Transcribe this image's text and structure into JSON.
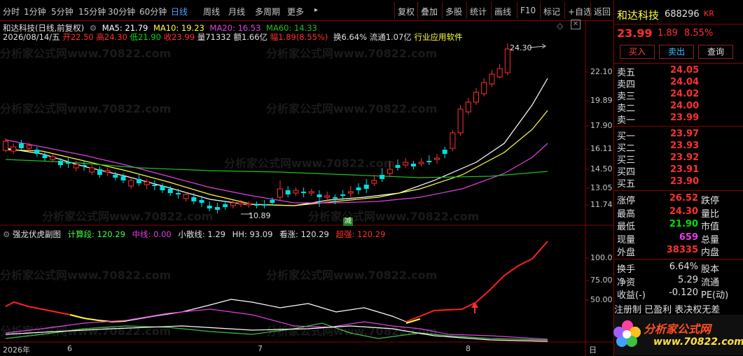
{
  "toolbar": {
    "periods": [
      "分时",
      "1分钟",
      "5分钟",
      "15分钟",
      "30分钟",
      "60分钟",
      "日线",
      "周线",
      "月线",
      "多周期",
      "更多"
    ],
    "more_arrow": "▸",
    "actions": [
      "复权",
      "叠加",
      "多股",
      "统计",
      "画线",
      "F10",
      "标记",
      "+自选",
      "返回"
    ]
  },
  "chart_header": {
    "title": "和达科技(日线,前复权)",
    "ma5": "MA5: 21.79",
    "ma10": "MA10: 19.23",
    "ma20": "MA20: 16.53",
    "ma60": "MA60: 14.33",
    "date": "2026/08/14/五",
    "open": "开22.50",
    "high": "高24.30",
    "low": "低21.90",
    "close": "收23.99",
    "volume": "量71332",
    "amount": "额1.66亿",
    "amplitude": "幅1.89(8.55%)",
    "turnover": "换6.64%",
    "float": "流通1.07亿",
    "industry": "行业应用软件"
  },
  "price_axis": [
    "22.10",
    "19.89",
    "17.90",
    "16.11",
    "14.50",
    "13.05",
    "11.74"
  ],
  "annotations": {
    "high": "24.30",
    "low": "10.89",
    "reduce": "减"
  },
  "indicator_header": {
    "name": "强龙伏虎副图",
    "calc": "计算段: 120.29",
    "mid": "中线: 0.00",
    "small": "小散线: 1.29",
    "hh": "HH: 93.09",
    "bull": "看涨: 120.29",
    "strong": "超强: 120.29"
  },
  "indicator_axis": [
    "100.0",
    "75.00",
    "50.00"
  ],
  "date_axis": {
    "start": "2026年",
    "m6": "6",
    "m7": "7",
    "m8": "8",
    "end_btn": "日"
  },
  "quote": {
    "name": "和达科技",
    "code": "688296",
    "tag": "KR",
    "price": "23.99",
    "change": "1.89",
    "pct": "8.55%",
    "buy_btn": "买入",
    "sell_btn": "卖出",
    "query_btn": "查询",
    "asks": [
      {
        "label": "卖五",
        "price": "24.05"
      },
      {
        "label": "卖四",
        "price": "24.04"
      },
      {
        "label": "卖三",
        "price": "24.02"
      },
      {
        "label": "卖二",
        "price": "24.00"
      },
      {
        "label": "卖一",
        "price": "23.99"
      }
    ],
    "bids": [
      {
        "label": "买一",
        "price": "23.97"
      },
      {
        "label": "买二",
        "price": "23.93"
      },
      {
        "label": "买三",
        "price": "23.92"
      },
      {
        "label": "买四",
        "price": "23.91"
      },
      {
        "label": "买五",
        "price": "23.90"
      }
    ],
    "stats": [
      {
        "l1": "涨停",
        "v1": "26.52",
        "l2": "跌停",
        "c": "#ff3030"
      },
      {
        "l1": "最高",
        "v1": "24.30",
        "l2": "量比",
        "c": "#ff3030"
      },
      {
        "l1": "最低",
        "v1": "21.90",
        "l2": "市值",
        "c": "#00e000"
      },
      {
        "l1": "现量",
        "v1": "659",
        "l2": "总量",
        "c": "#e040e0"
      },
      {
        "l1": "外盘",
        "v1": "38335",
        "l2": "内盘",
        "c": "#ff3030"
      }
    ],
    "stats2": [
      {
        "l1": "换手",
        "v1": "6.64%",
        "l2": "股本"
      },
      {
        "l1": "净资",
        "v1": "5.29",
        "l2": "流通"
      },
      {
        "l1": "收益(-)",
        "v1": "-0.120",
        "l2": "PE(动)"
      }
    ],
    "note": "注册制 已盈利 表决权无差"
  },
  "watermark": {
    "text": "分析家公式网www.70822.com",
    "logo_title": "分析家公式网",
    "logo_url": "www.70822.com"
  },
  "colors": {
    "up": "#ff3030",
    "down": "#00e0e0",
    "ma5": "#ffffff",
    "ma10": "#ffff40",
    "ma20": "#e040e0",
    "ma60": "#20c020",
    "accent": "#4da3ff"
  }
}
